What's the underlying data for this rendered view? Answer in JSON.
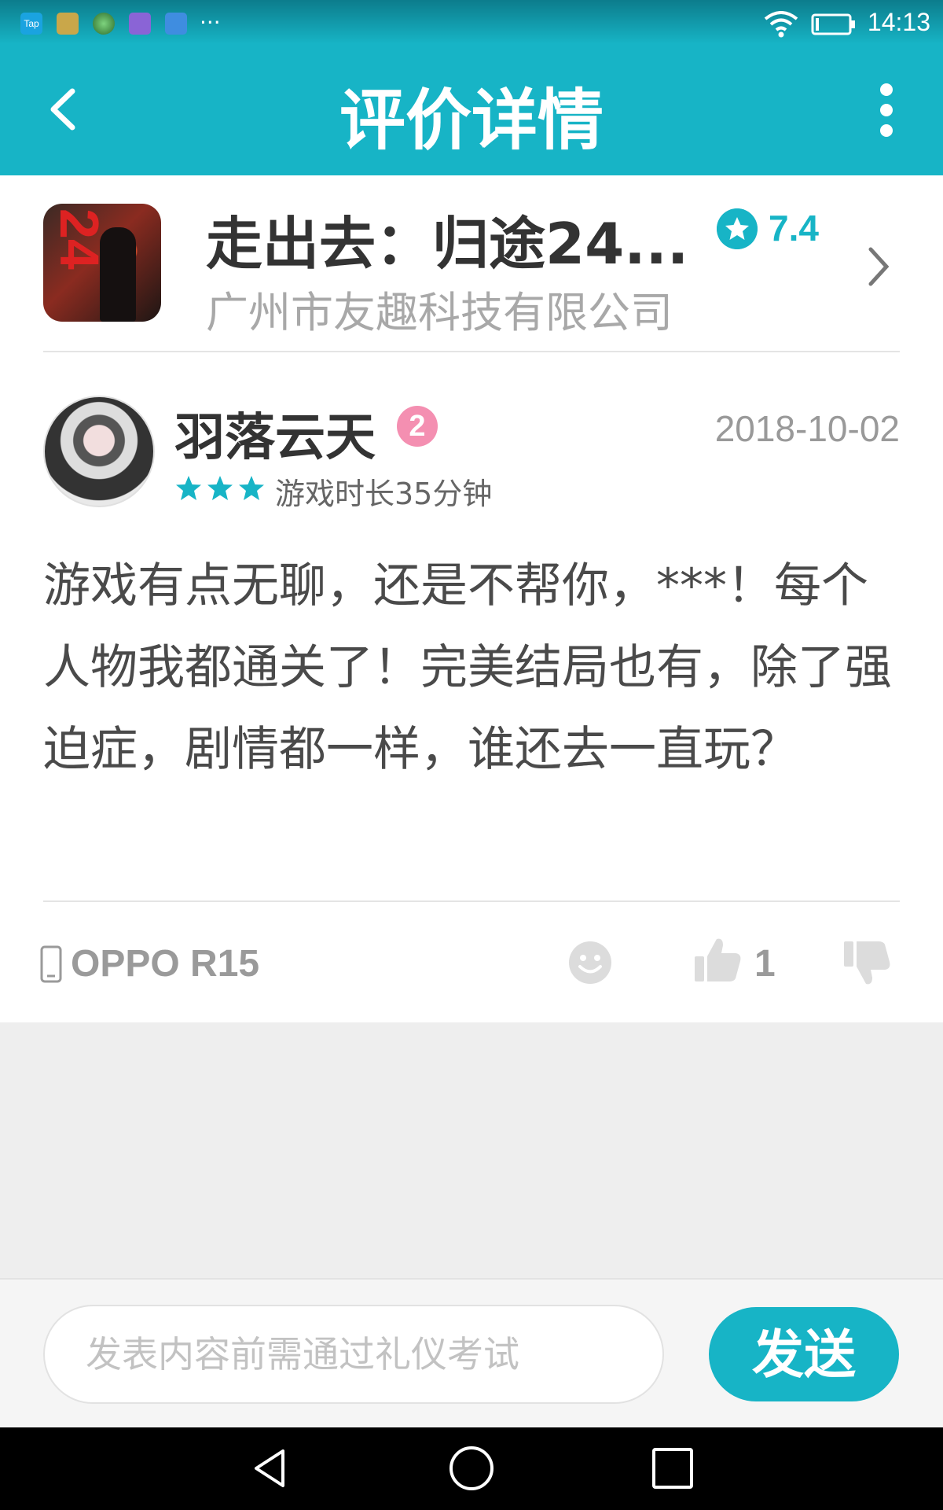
{
  "status_bar": {
    "time": "14:13",
    "left_icons": [
      "tap-app-icon",
      "game-app-icon",
      "browser-icon",
      "gallery-icon",
      "info-icon",
      "more-notifications-icon"
    ],
    "right_icons": [
      "wifi-icon",
      "battery-icon"
    ]
  },
  "header": {
    "title": "评价详情",
    "back_icon": "chevron-left-icon",
    "menu_icon": "more-vertical-icon"
  },
  "app": {
    "name": "走出去：归途24...",
    "score": "7.4",
    "developer": "广州市友趣科技有限公司",
    "icon_label": "24"
  },
  "review": {
    "user_name": "羽落云天",
    "level": "2",
    "date": "2018-10-02",
    "stars": 3,
    "playtime": "游戏时长35分钟",
    "body": "游戏有点无聊，还是不帮你，***！每个人物我都通关了！完美结局也有，除了强迫症，剧情都一样，谁还去一直玩？",
    "device": "OPPO R15",
    "likes": "1"
  },
  "composer": {
    "placeholder": "发表内容前需通过礼仪考试",
    "send_label": "发送"
  },
  "colors": {
    "accent": "#17b4c6",
    "text_dark": "#333333",
    "text_muted": "#9a9a9a",
    "background": "#eeeeee"
  }
}
